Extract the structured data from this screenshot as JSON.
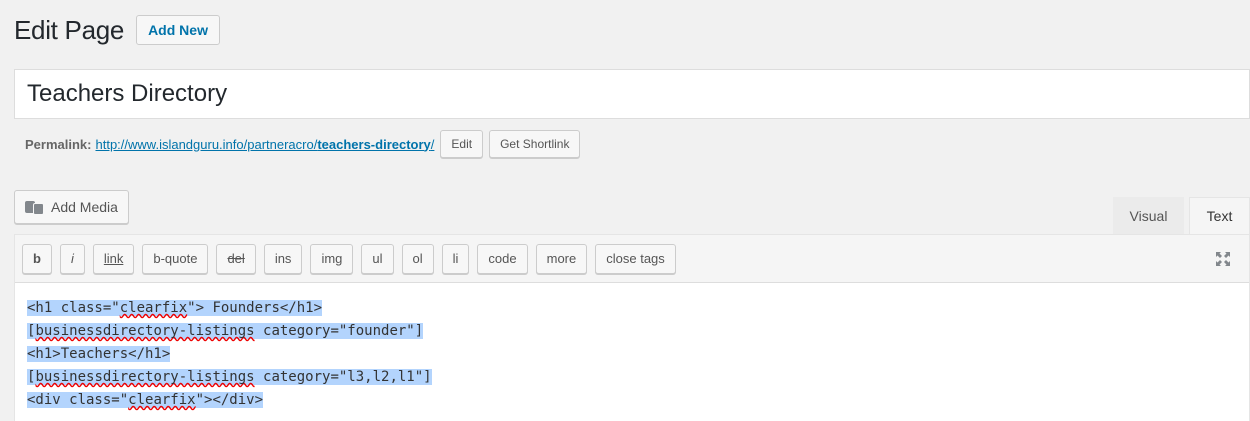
{
  "header": {
    "title": "Edit Page",
    "add_new_label": "Add New"
  },
  "title_field": {
    "value": "Teachers Directory"
  },
  "permalink": {
    "label": "Permalink:",
    "url_base": "http://www.islandguru.info/partneracro/",
    "slug": "teachers-directory",
    "url_tail": "/",
    "edit_label": "Edit",
    "shortlink_label": "Get Shortlink"
  },
  "media": {
    "add_media_label": "Add Media",
    "icon": "add-media-icon"
  },
  "editor_tabs": {
    "visual": "Visual",
    "text": "Text",
    "active": "Text"
  },
  "quicktags": [
    "b",
    "i",
    "link",
    "b-quote",
    "del",
    "ins",
    "img",
    "ul",
    "ol",
    "li",
    "code",
    "more",
    "close tags"
  ],
  "content": {
    "lines": [
      [
        "<h1 class=\"",
        "clearfix",
        "\"> Founders</h1>"
      ],
      [
        "[",
        "businessdirectory-listings",
        " category=\"founder\"]"
      ],
      [
        "<h1>Teachers</h1>",
        "",
        ""
      ],
      [
        "[",
        "businessdirectory-listings",
        " category=\"l3,l2,l1\"]"
      ],
      [
        "<div class=\"",
        "clearfix",
        "\"></div>"
      ]
    ]
  },
  "colors": {
    "link": "#0073aa",
    "selection": "#b3d4fd",
    "background": "#f1f1f1"
  }
}
